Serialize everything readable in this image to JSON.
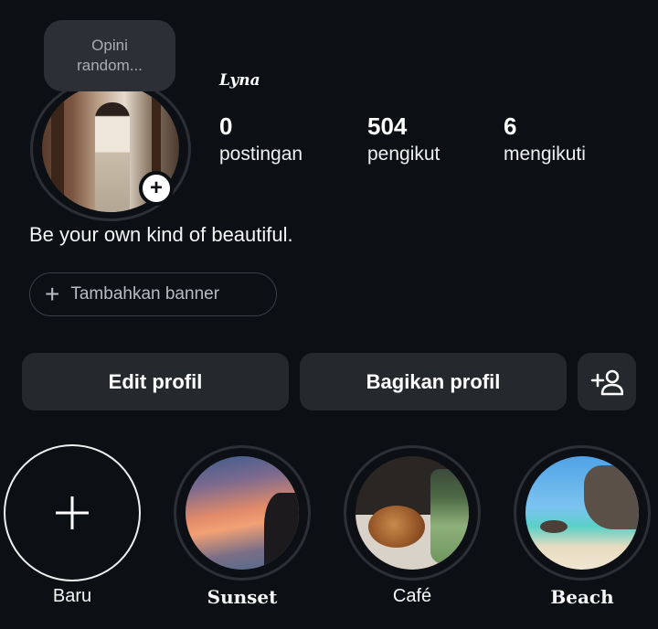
{
  "profile": {
    "note": [
      "Opini",
      "random..."
    ],
    "username": "Lyna",
    "bio": "Be your own kind of beautiful.",
    "stats": [
      {
        "num": "0",
        "label": "postingan"
      },
      {
        "num": "504",
        "label": "pengikut"
      },
      {
        "num": "6",
        "label": "mengikuti"
      }
    ]
  },
  "actions": {
    "banner_label": "Tambahkan banner",
    "edit_label": "Edit profil",
    "share_label": "Bagikan profil",
    "add_friend_icon": "add-person-icon"
  },
  "highlights": {
    "new_label": "Baru",
    "items": [
      {
        "label": "Sunset"
      },
      {
        "label": "Café"
      },
      {
        "label": "Beach"
      }
    ]
  },
  "colors": {
    "background": "#0c1014",
    "button": "#25292e",
    "ring": "#2c3036",
    "text": "#f5f5f5"
  }
}
